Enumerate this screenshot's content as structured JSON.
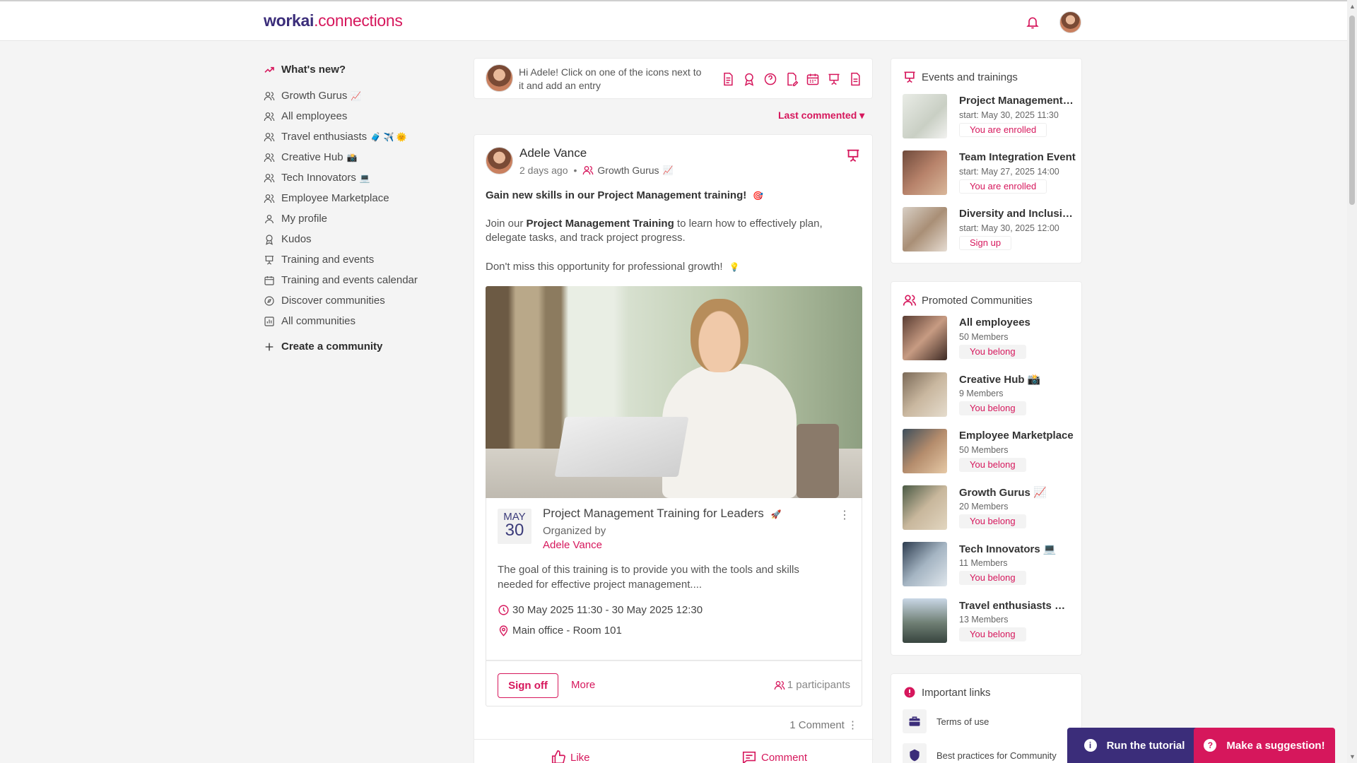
{
  "app": {
    "logo_brand": "workai",
    "logo_dot": ".connections"
  },
  "colors": {
    "accent": "#d6175c",
    "brand": "#3b2d7a"
  },
  "leftnav": {
    "whats_new": "What's new?",
    "items": [
      {
        "label": "Growth Gurus",
        "emoji": "📈",
        "icon": "users-icon"
      },
      {
        "label": "All employees",
        "emoji": "",
        "icon": "users-icon"
      },
      {
        "label": "Travel enthusiasts",
        "emoji": "🧳 ✈️ 🌞",
        "icon": "users-icon"
      },
      {
        "label": "Creative Hub",
        "emoji": "📸",
        "icon": "users-icon"
      },
      {
        "label": "Tech Innovators",
        "emoji": "💻",
        "icon": "users-icon"
      },
      {
        "label": "Employee Marketplace",
        "emoji": "",
        "icon": "users-icon"
      },
      {
        "label": "My profile",
        "emoji": "",
        "icon": "user-icon"
      },
      {
        "label": "Kudos",
        "emoji": "",
        "icon": "award-icon"
      },
      {
        "label": "Training and events",
        "emoji": "",
        "icon": "presentation-icon"
      },
      {
        "label": "Training and events calendar",
        "emoji": "",
        "icon": "calendar-icon"
      },
      {
        "label": "Discover communities",
        "emoji": "",
        "icon": "compass-icon"
      },
      {
        "label": "All communities",
        "emoji": "",
        "icon": "chart-icon"
      }
    ],
    "create": "Create a community"
  },
  "composer": {
    "prompt": "Hi Adele! Click on one of the icons next to it and add an entry"
  },
  "sort_label": "Last commented",
  "post": {
    "author": "Adele Vance",
    "time": "2 days ago",
    "group": "Growth Gurus",
    "group_emoji": "📈",
    "headline": "Gain new skills in our Project Management training!",
    "headline_emoji": "🎯",
    "body_pre": "Join our ",
    "body_bold": "Project Management Training",
    "body_post": " to learn how to effectively plan, delegate tasks, and track project progress.",
    "body2": "Don't miss this opportunity for professional growth!",
    "body2_emoji": "💡",
    "event": {
      "month": "MAY",
      "day": "30",
      "title": "Project Management Training for Leaders",
      "title_emoji": "🚀",
      "organized_by": "Organized by",
      "organizer": "Adele Vance",
      "description": "The goal of this training is to provide you with the tools and skills needed for effective project management....",
      "when": "30 May 2025 11:30 - 30 May 2025 12:30",
      "where": "Main office - Room 101"
    },
    "sign_off": "Sign off",
    "more": "More",
    "participants": "1 participants",
    "comments": "1 Comment",
    "like": "Like",
    "comment": "Comment"
  },
  "events_card": {
    "title": "Events and trainings",
    "items": [
      {
        "name": "Project Management Training for Leaders",
        "start": "start: May 30, 2025 11:30",
        "status": "You are enrolled"
      },
      {
        "name": "Team Integration Event",
        "start": "start: May 27, 2025 14:00",
        "status": "You are enrolled"
      },
      {
        "name": "Diversity and Inclusion Workshop",
        "start": "start: May 30, 2025 12:00",
        "status": "Sign up"
      }
    ]
  },
  "communities_card": {
    "title": "Promoted Communities",
    "items": [
      {
        "name": "All employees",
        "members": "50 Members",
        "status": "You belong"
      },
      {
        "name": "Creative Hub 📸",
        "members": "9 Members",
        "status": "You belong"
      },
      {
        "name": "Employee Marketplace",
        "members": "50 Members",
        "status": "You belong"
      },
      {
        "name": "Growth Gurus 📈",
        "members": "20 Members",
        "status": "You belong"
      },
      {
        "name": "Tech Innovators 💻",
        "members": "11 Members",
        "status": "You belong"
      },
      {
        "name": "Travel enthusiasts 🧳✈️🌞",
        "members": "13 Members",
        "status": "You belong"
      }
    ]
  },
  "links_card": {
    "title": "Important links",
    "items": [
      {
        "label": "Terms of use"
      },
      {
        "label": "Best practices for Community"
      }
    ]
  },
  "buttons": {
    "tutorial": "Run the tutorial",
    "suggest": "Make a suggestion!"
  }
}
